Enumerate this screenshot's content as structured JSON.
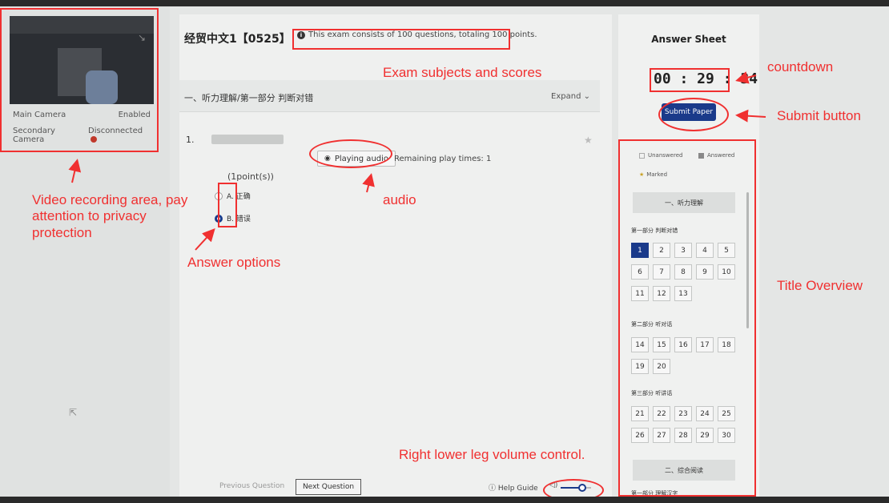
{
  "cameras": {
    "main_label": "Main Camera",
    "main_status": "Enabled",
    "secondary_label": "Secondary Camera",
    "secondary_status": "Disconnected"
  },
  "exam": {
    "title": "经贸中文1【0525】",
    "note": "This exam consists of 100 questions, totaling 100 points."
  },
  "section": {
    "title": "一、听力理解/第一部分 判断对错",
    "expand": "Expand"
  },
  "question": {
    "number": "1.",
    "play_label": "Playing audio",
    "remaining": "Remaining play times: 1",
    "points": "(1point(s))",
    "options": [
      {
        "label": "A. 正确",
        "selected": false
      },
      {
        "label": "B. 错误",
        "selected": true
      }
    ]
  },
  "footer": {
    "prev": "Previous Question",
    "next": "Next Question",
    "help": "Help Guide",
    "volume_fraction": 0.7
  },
  "sheet": {
    "title": "Answer Sheet",
    "timer": "00 : 29 : 34",
    "submit": "Submit Paper",
    "legend": {
      "unanswered": "Unanswered",
      "answered": "Answered",
      "marked": "Marked"
    },
    "group1": "一、听力理解",
    "part1": "第一部分 判断对错",
    "part1_items": [
      "1",
      "2",
      "3",
      "4",
      "5",
      "6",
      "7",
      "8",
      "9",
      "10",
      "11",
      "12",
      "13"
    ],
    "part2": "第二部分 听对话",
    "part2_items": [
      "14",
      "15",
      "16",
      "17",
      "18",
      "19",
      "20"
    ],
    "part3": "第三部分 听讲话",
    "part3_items": [
      "21",
      "22",
      "23",
      "24",
      "25",
      "26",
      "27",
      "28",
      "29",
      "30"
    ],
    "group2": "二、综合阅读",
    "part4": "第一部分 理解汉字",
    "active": "1"
  },
  "annotations": {
    "subjects": "Exam subjects and scores",
    "countdown": "countdown",
    "submit": "Submit button",
    "video": "Video recording area, pay attention to privacy protection",
    "audio": "audio",
    "options": "Answer options",
    "overview": "Title Overview",
    "volume": "Right lower leg volume control."
  },
  "colors": {
    "accent": "#1a3a8a",
    "annotation": "#f03030"
  }
}
